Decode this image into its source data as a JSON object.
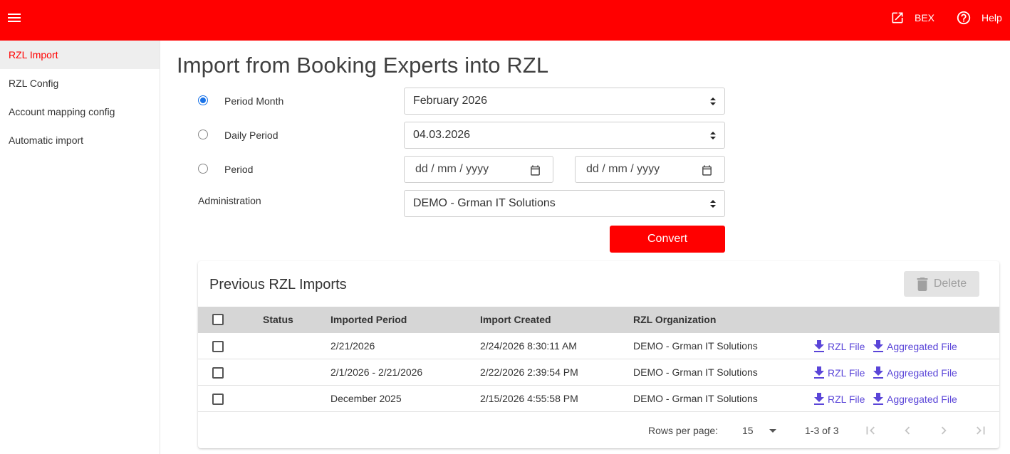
{
  "topbar": {
    "bex_label": "BEX",
    "help_label": "Help",
    "color": "#ff0000"
  },
  "sidebar": {
    "items": [
      {
        "label": "RZL Import",
        "active": true
      },
      {
        "label": "RZL Config"
      },
      {
        "label": "Account mapping config"
      },
      {
        "label": "Automatic import"
      }
    ]
  },
  "page": {
    "title": "Import from Booking Experts into RZL"
  },
  "form": {
    "period_month": {
      "label": "Period Month",
      "value": "February 2026",
      "checked": true
    },
    "daily_period": {
      "label": "Daily Period",
      "value": "04.03.2026",
      "checked": false
    },
    "period": {
      "label": "Period",
      "from_placeholder": "dd / mm / yyyy",
      "to_placeholder": "dd / mm / yyyy",
      "checked": false
    },
    "administration": {
      "label": "Administration",
      "value": "DEMO - Grman IT Solutions"
    },
    "convert_label": "Convert"
  },
  "imports": {
    "title": "Previous RZL Imports",
    "delete_label": "Delete",
    "columns": [
      "Status",
      "Imported Period",
      "Import Created",
      "RZL Organization"
    ],
    "rows": [
      {
        "status": "",
        "period": "2/21/2026",
        "created": "2/24/2026 8:30:11 AM",
        "org": "DEMO - Grman IT Solutions",
        "rzl_file": "RZL File",
        "agg_file": "Aggregated File"
      },
      {
        "status": "",
        "period": "2/1/2026 - 2/21/2026",
        "created": "2/22/2026 2:39:54 PM",
        "org": "DEMO - Grman IT Solutions",
        "rzl_file": "RZL File",
        "agg_file": "Aggregated File"
      },
      {
        "status": "",
        "period": "December 2025",
        "created": "2/15/2026 4:55:58 PM",
        "org": "DEMO - Grman IT Solutions",
        "rzl_file": "RZL File",
        "agg_file": "Aggregated File"
      }
    ],
    "footer": {
      "rows_per_page_label": "Rows per page:",
      "rows_per_page_value": "15",
      "range": "1-3 of 3"
    }
  }
}
